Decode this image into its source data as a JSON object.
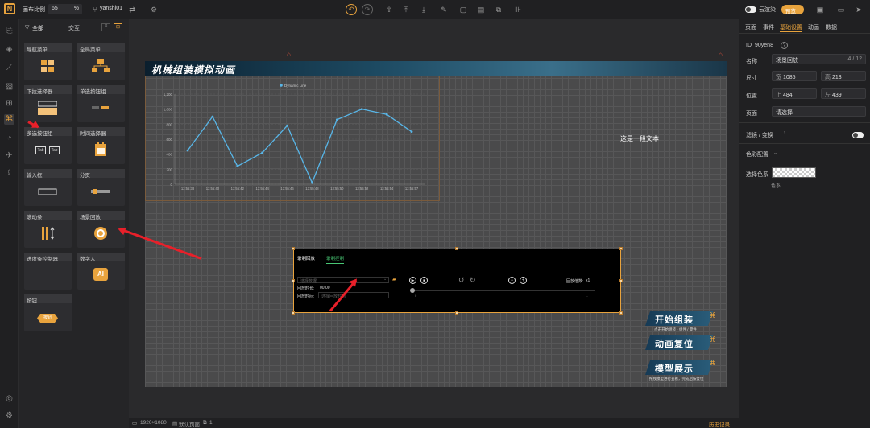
{
  "topbar": {
    "logo": "N",
    "zoom_label": "画布比例",
    "zoom_value": "65",
    "zoom_unit": "%",
    "project_name": "yanshi01",
    "cloud_render_label": "云渲染",
    "preview_label": "预览"
  },
  "panel": {
    "tab_all": "全部",
    "tab_interaction": "交互",
    "components": [
      {
        "label": "导航菜单"
      },
      {
        "label": "全局菜单"
      },
      {
        "label": "下拉选择器"
      },
      {
        "label": "单选按钮组"
      },
      {
        "label": "多选按钮组"
      },
      {
        "label": "时间选择器"
      },
      {
        "label": "输入框"
      },
      {
        "label": "分页"
      },
      {
        "label": "滚动条"
      },
      {
        "label": "场景回放"
      },
      {
        "label": "进度条控制器"
      },
      {
        "label": "数字人"
      },
      {
        "label": "按钮"
      }
    ],
    "multi_btn_text": "Tab",
    "button_comp_text": "按钮",
    "digital_human_text": "AI"
  },
  "canvas": {
    "title": "机械组装模拟动画",
    "sample_text": "这是一段文本",
    "buttons": [
      {
        "label": "开始组装",
        "sub": "点击开始组装 · 组件 / 零件"
      },
      {
        "label": "动画复位",
        "sub": ""
      },
      {
        "label": "模型展示",
        "sub": "拖拽模型进行查看，完成后按复位"
      }
    ]
  },
  "chart_data": {
    "type": "line",
    "legend": [
      "Dynamic Line"
    ],
    "x": [
      "13:55:38",
      "13:55:40",
      "13:55:42",
      "13:55:44",
      "13:55:46",
      "13:55:48",
      "13:55:50",
      "13:55:52",
      "13:55:54",
      "13:55:57"
    ],
    "series": [
      {
        "name": "Dynamic Line",
        "values": [
          450,
          900,
          240,
          420,
          780,
          20,
          860,
          1000,
          930,
          700
        ]
      }
    ],
    "yticks": [
      "0",
      "200",
      "400",
      "600",
      "800",
      "1,000",
      "1,200"
    ],
    "ylim": [
      0,
      1200
    ],
    "color": "#58b6e8"
  },
  "player": {
    "tab_record": "录制回放",
    "tab_control": "录制控制",
    "select_placeholder": "选择数据",
    "time_label": "回放时长:",
    "time_value": "00:00",
    "time2_label": "回放时间:",
    "time2_placeholder": "选择回放时间",
    "speed_label": "回放倍数:",
    "speed_value": "x1",
    "start": "0",
    "end": "--"
  },
  "bottombar": {
    "resolution": "1920×1080",
    "page_label": "默认页面",
    "page_count": "1",
    "history": "历史记录"
  },
  "rpanel": {
    "tabs": [
      "页面",
      "事件",
      "基础设置",
      "动画",
      "数据"
    ],
    "active_tab": "基础设置",
    "id_label": "ID",
    "id_value": "90yen8",
    "name_label": "名称",
    "name_value": "场景回放",
    "name_count": "4 / 12",
    "size_label": "尺寸",
    "width_prefix": "宽",
    "width_value": "1085",
    "height_prefix": "高",
    "height_value": "213",
    "pos_label": "位置",
    "top_prefix": "上",
    "top_value": "484",
    "left_prefix": "左",
    "left_value": "439",
    "page_label": "页面",
    "page_value": "请选择",
    "filter_label": "滤镜 / 变换",
    "color_section": "色彩配置",
    "color_pick_label": "选择色系",
    "color_sub": "色系"
  },
  "colors": {
    "accent": "#e8a33d",
    "arrow": "#e8202a",
    "line": "#58b6e8"
  }
}
